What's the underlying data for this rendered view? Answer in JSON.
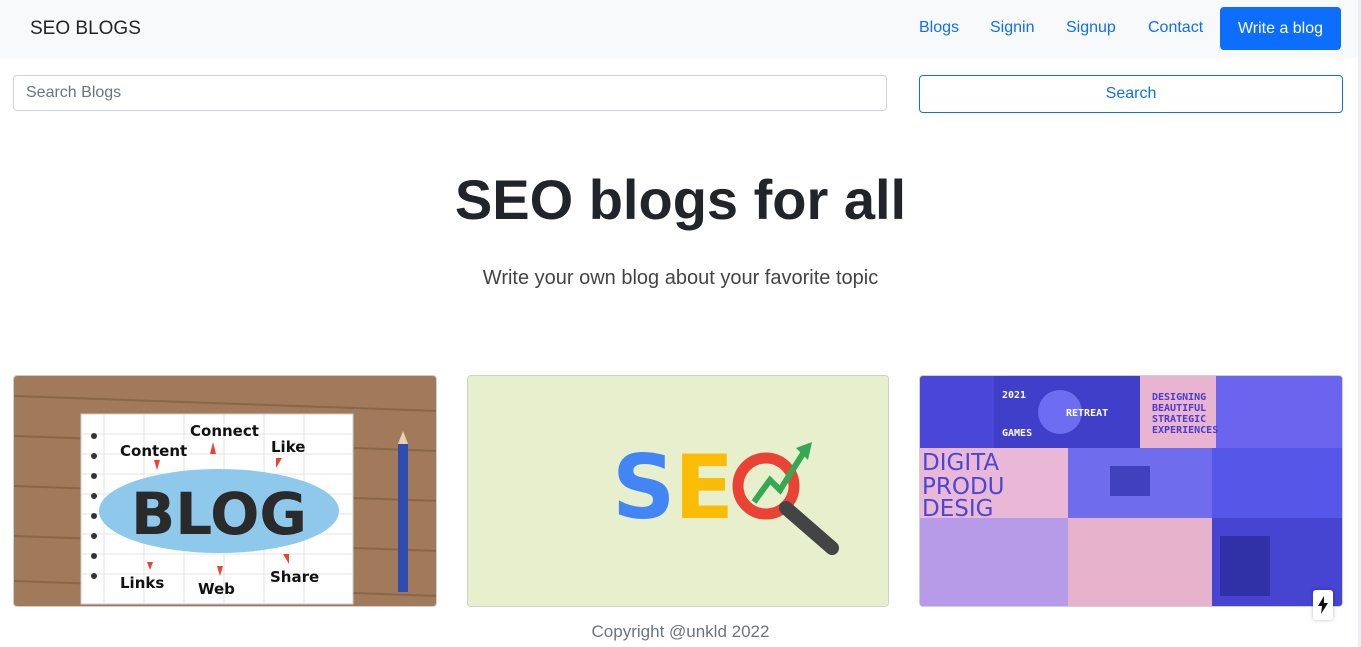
{
  "navbar": {
    "brand": "SEO BLOGS",
    "links": [
      "Blogs",
      "Signin",
      "Signup",
      "Contact"
    ],
    "cta_label": "Write a blog"
  },
  "search": {
    "placeholder": "Search Blogs",
    "button_label": "Search"
  },
  "hero": {
    "title": "SEO blogs for all",
    "subtitle": "Write your own blog about your favorite topic"
  },
  "cards": {
    "blog": {
      "words": [
        "Content",
        "Connect",
        "Like",
        "BLOG",
        "Links",
        "Web",
        "Share"
      ]
    },
    "seo": {
      "letters": [
        "S",
        "E",
        "O"
      ]
    },
    "design": {
      "texts": [
        "2021",
        "GAMES",
        "RETREAT",
        "DESIGNING",
        "BEAUTIFUL",
        "STRATEGIC",
        "EXPERIENCES",
        "DIGITA",
        "PRODU",
        "DESIG"
      ]
    }
  },
  "footer": {
    "copyright": "Copyright @unkld 2022"
  },
  "colors": {
    "primary": "#0d6efd",
    "navbar_bg": "#f8f9fa",
    "seo_blue": "#4285F4",
    "seo_yellow": "#FBBC05",
    "seo_red": "#EA4335",
    "seo_green": "#34A853"
  },
  "icons": {
    "bolt": "lightning-bolt-icon"
  }
}
